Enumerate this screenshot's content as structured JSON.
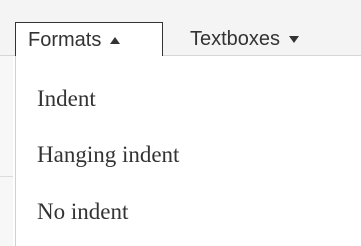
{
  "toolbar": {
    "menus": [
      {
        "label": "Formats",
        "state": "open",
        "caret_icon": "caret-up-icon"
      },
      {
        "label": "Textboxes",
        "state": "closed",
        "caret_icon": "caret-down-icon"
      }
    ]
  },
  "dropdown": {
    "items": [
      {
        "label": "Indent"
      },
      {
        "label": "Hanging indent"
      },
      {
        "label": "No indent"
      }
    ]
  },
  "colors": {
    "text": "#333333",
    "toolbar_background": "#f4f4f4",
    "menu_background": "#ffffff",
    "border": "#333333"
  }
}
